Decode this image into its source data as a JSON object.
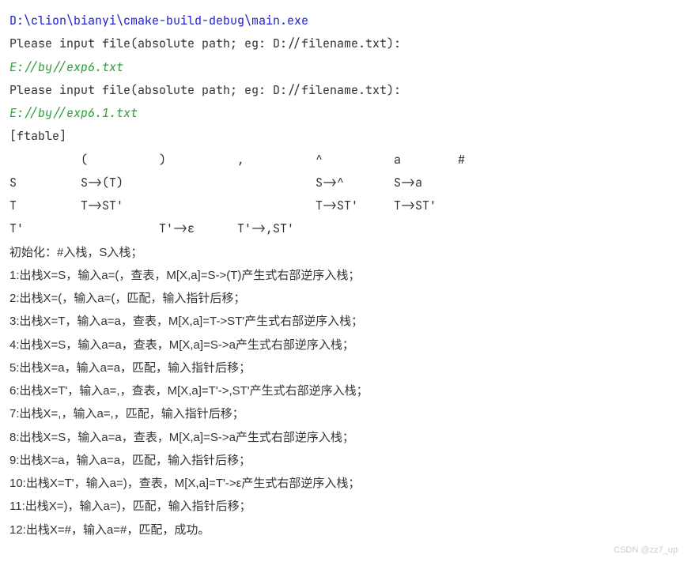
{
  "exe_path": "D:\\clion\\bianyi\\cmake-build-debug\\main.exe",
  "prompt1": "Please input file(absolute path; eg: D://filename.txt):",
  "input1": "E://by//exp6.txt",
  "prompt2": "Please input file(absolute path; eg: D://filename.txt):",
  "input2": "E://by//exp6.1.txt",
  "ftable_label": "[ftable]",
  "table": {
    "header": "          (          )          ,          ^          a        #",
    "row1": "S         S->(T)                           S->^       S->a",
    "row2": "T         T->ST'                           T->ST'     T->ST'",
    "row3": "T'                   T'->ε      T'->,ST'"
  },
  "init_line": "初始化：#入栈，S入栈；",
  "steps": {
    "s1": "1:出栈X=S，输入a=(，查表，M[X,a]=S->(T)产生式右部逆序入栈；",
    "s2": "2:出栈X=(，输入a=(，匹配，输入指针后移；",
    "s3": "3:出栈X=T，输入a=a，查表，M[X,a]=T->ST'产生式右部逆序入栈；",
    "s4": "4:出栈X=S，输入a=a，查表，M[X,a]=S->a产生式右部逆序入栈；",
    "s5": "5:出栈X=a，输入a=a，匹配，输入指针后移；",
    "s6": "6:出栈X=T'，输入a=,，查表，M[X,a]=T'->,ST'产生式右部逆序入栈；",
    "s7": "7:出栈X=,，输入a=,，匹配，输入指针后移；",
    "s8": "8:出栈X=S，输入a=a，查表，M[X,a]=S->a产生式右部逆序入栈；",
    "s9": "9:出栈X=a，输入a=a，匹配，输入指针后移；",
    "s10": "10:出栈X=T'，输入a=)，查表，M[X,a]=T'->ε产生式右部逆序入栈；",
    "s11": "11:出栈X=)，输入a=)，匹配，输入指针后移；",
    "s12": "12:出栈X=#，输入a=#，匹配，成功。"
  },
  "watermark": "CSDN @zz7_up"
}
